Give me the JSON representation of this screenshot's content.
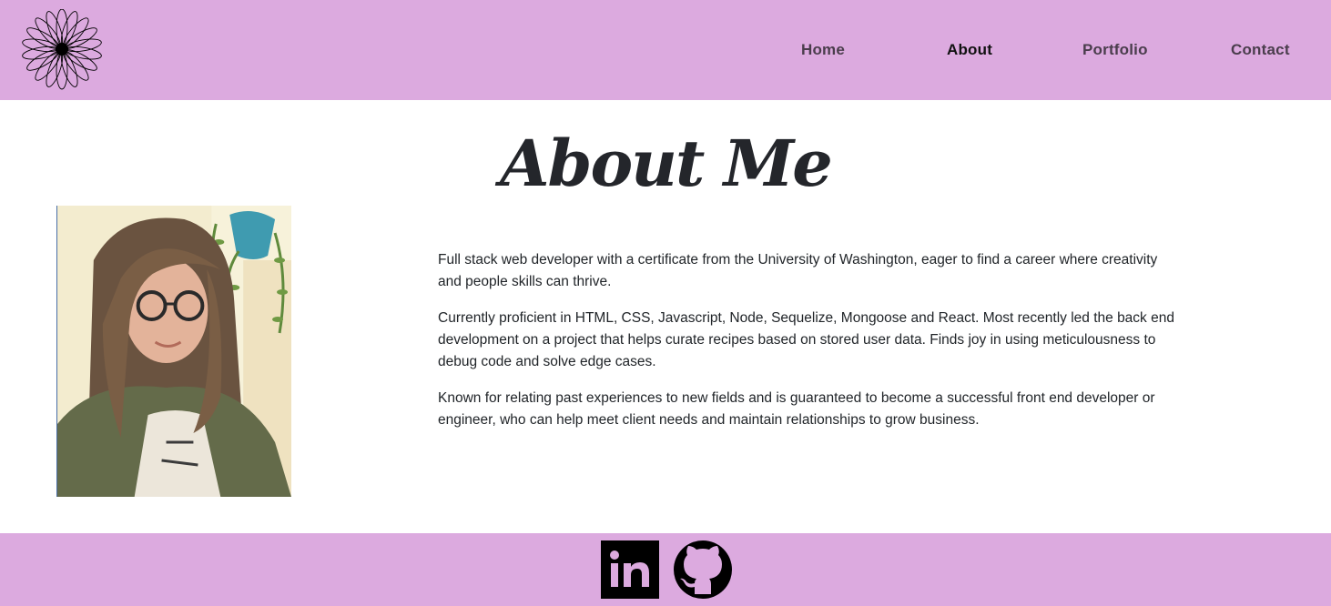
{
  "header": {
    "logo_icon": "daisy-flower-icon",
    "nav": [
      {
        "label": "Home",
        "active": false
      },
      {
        "label": "About",
        "active": true
      },
      {
        "label": "Portfolio",
        "active": false
      },
      {
        "label": "Contact",
        "active": false
      }
    ]
  },
  "main": {
    "title": "About Me",
    "bio": [
      "Full stack web developer with a certificate from the University of Washington, eager to find a career where creativity and people skills can thrive.",
      "Currently proficient in HTML, CSS, Javascript, Node, Sequelize, Mongoose and React. Most recently led the back end development on a project that helps curate recipes based on stored user data. Finds joy in using meticulousness to debug code and solve edge cases.",
      "Known for relating past experiences to new fields and is guaranteed to become a successful front end developer or engineer, who can help meet client needs and maintain relationships to grow business."
    ]
  },
  "footer": {
    "social": [
      {
        "icon": "linkedin-icon"
      },
      {
        "icon": "github-icon"
      }
    ]
  },
  "colors": {
    "header_footer_bg": "#dcaadf",
    "nav_text": "#4a3d4c",
    "nav_active": "#111111",
    "title": "#24262b",
    "body_text": "#212529"
  }
}
